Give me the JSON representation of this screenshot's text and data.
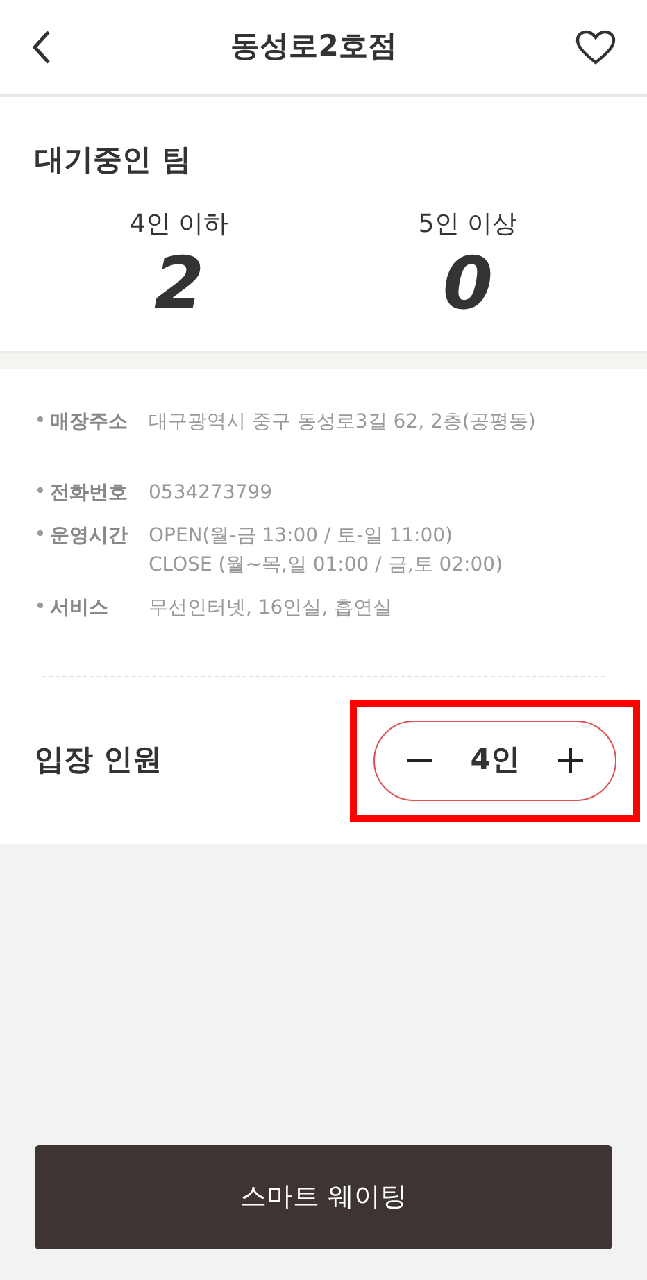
{
  "header": {
    "title": "동성로2호점",
    "favorite": false
  },
  "waiting": {
    "title": "대기중인 팀",
    "groups": [
      {
        "label": "4인 이하",
        "count": "2"
      },
      {
        "label": "5인 이상",
        "count": "0"
      }
    ]
  },
  "info": [
    {
      "label": "매장주소",
      "lines": [
        "대구광역시 중구 동성로3길 62, 2층(공평동)"
      ]
    },
    {
      "label": "전화번호",
      "lines": [
        "0534273799"
      ]
    },
    {
      "label": "운영시간",
      "lines": [
        "OPEN(월-금 13:00 / 토-일 11:00)",
        "CLOSE (월~목,일 01:00 / 금,토 02:00)"
      ]
    },
    {
      "label": "서비스",
      "lines": [
        "무선인터넷, 16인실, 흡연실"
      ]
    }
  ],
  "party": {
    "label": "입장 인원",
    "value": "4인",
    "highlight": true
  },
  "submit": "스마트 웨이팅"
}
